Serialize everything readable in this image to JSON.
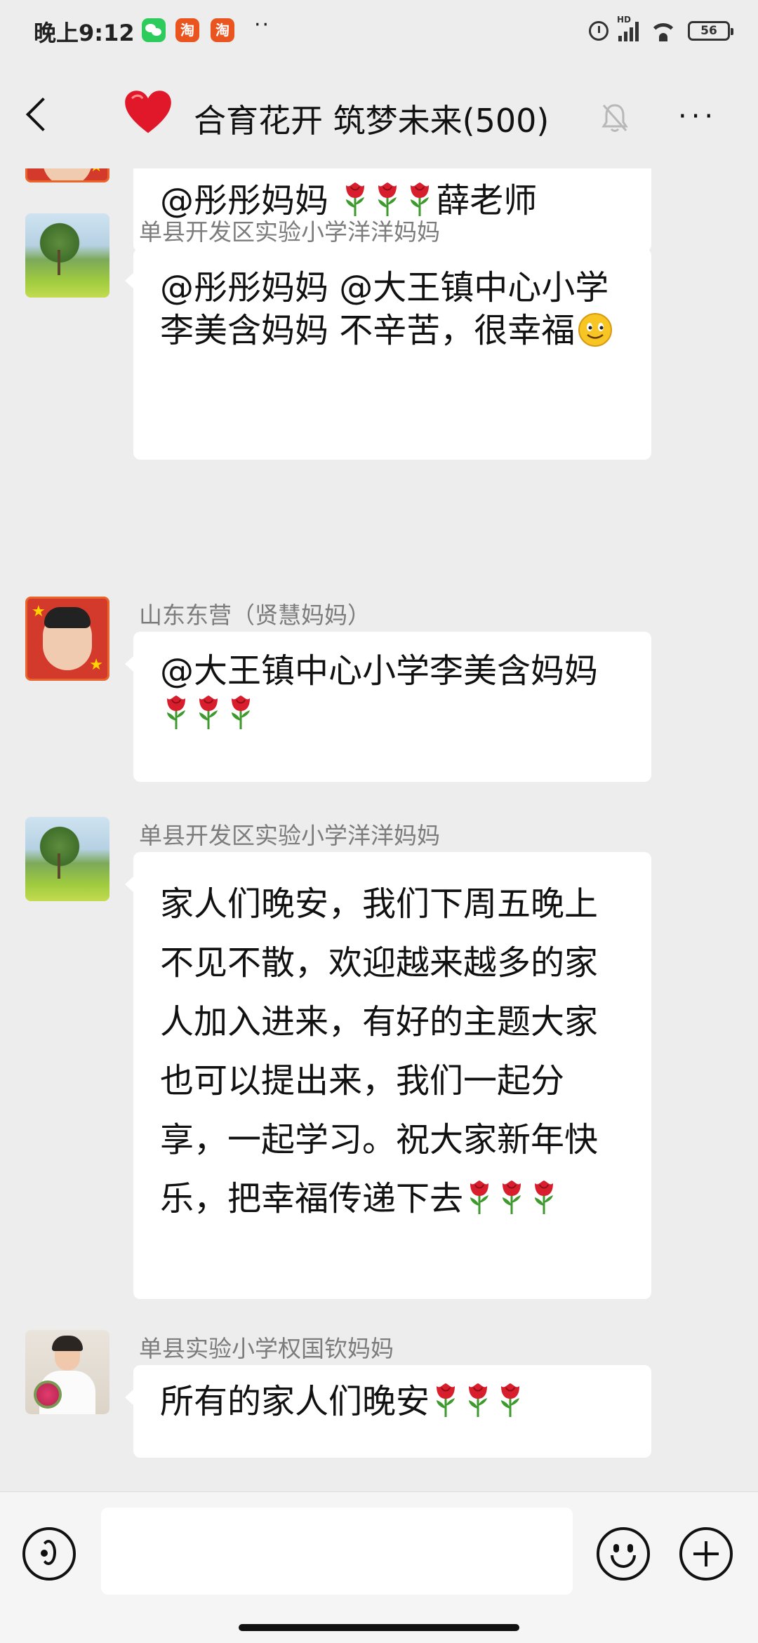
{
  "status_bar": {
    "time": "晚上9:12",
    "taobao_glyph": "淘",
    "more": "··",
    "network_label": "HD",
    "battery": "56"
  },
  "header": {
    "title": "合育花开 筑梦未来(500)",
    "heart_icon": "red-heart-emoji",
    "mute_icon": "bell-muted-icon",
    "menu_label": "···"
  },
  "messages": [
    {
      "nick": "",
      "avatar": "partial-avatar",
      "parts": [
        "@彤彤妈妈 ",
        "rose",
        "rose",
        "rose",
        "薛老师"
      ]
    },
    {
      "nick": "单县开发区实验小学洋洋妈妈",
      "avatar": "landscape-avatar",
      "parts": [
        "@彤彤妈妈 @大王镇中心小学李美含妈妈  不辛苦，很幸福",
        "smile"
      ]
    },
    {
      "nick": "山东东营（贤慧妈妈）",
      "avatar": "child-avatar",
      "parts": [
        "@大王镇中心小学李美含妈妈 ",
        "rose",
        "rose",
        "rose"
      ]
    },
    {
      "nick": "单县开发区实验小学洋洋妈妈",
      "avatar": "landscape-avatar",
      "parts": [
        "家人们晚安，我们下周五晚上不见不散，欢迎越来越多的家人加入进来，有好的主题大家也可以提出来，我们一起分享，一起学习。祝大家新年快乐，把幸福传递下去",
        "rose",
        "rose",
        "rose"
      ]
    },
    {
      "nick": "单县实验小学权国钦妈妈",
      "avatar": "woman-avatar",
      "parts": [
        "所有的家人们晚安",
        "rose",
        "rose",
        "rose"
      ]
    }
  ],
  "input_bar": {
    "placeholder": "",
    "voice_icon": "voice-icon",
    "emoji_icon": "emoji-icon",
    "plus_icon": "plus-icon"
  },
  "colors": {
    "background": "#ededed",
    "bubble": "#ffffff",
    "nick": "#7c7c7c",
    "rose": "#d81e2c"
  }
}
